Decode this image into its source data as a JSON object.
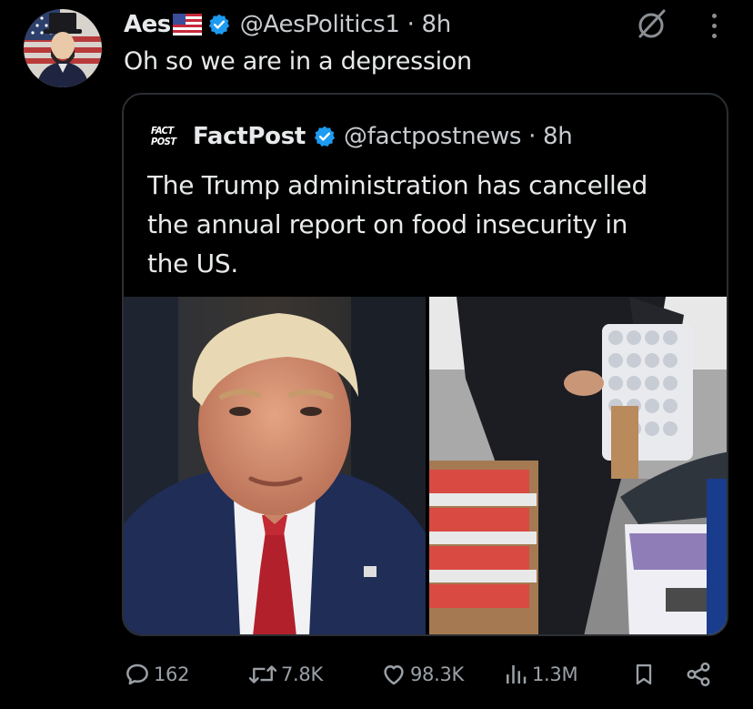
{
  "post": {
    "author_name": "Aes",
    "author_handle": "@AesPolitics1 · 8h",
    "text": "Oh so we are in a depression"
  },
  "quoted": {
    "logo_line1": "FACT",
    "logo_line2": "POST",
    "author_name": "FactPost",
    "author_handle": "@factpostnews · 8h",
    "text": "The Trump administration has cancelled the annual report on food insecurity in the US.",
    "text_lines": [
      "The Trump administration has cancelled",
      "the annual report on food insecurity in",
      "the US."
    ]
  },
  "actions": {
    "replies": "162",
    "reposts": "7.8K",
    "likes": "98.3K",
    "views": "1.3M"
  },
  "icons": {
    "verified": "verified-badge-icon",
    "flag": "us-flag-icon",
    "grok": "grok-icon",
    "more": "more-dots-icon",
    "reply": "reply-bubble-icon",
    "repost": "repost-icon",
    "like": "heart-icon",
    "views": "views-bars-icon",
    "bookmark": "bookmark-icon",
    "share": "share-icon"
  },
  "colors": {
    "background": "#000000",
    "text": "#e7e9ea",
    "muted": "#9aa0a6",
    "verified_blue": "#1d9bf0",
    "card_border": "#2b2f33"
  }
}
